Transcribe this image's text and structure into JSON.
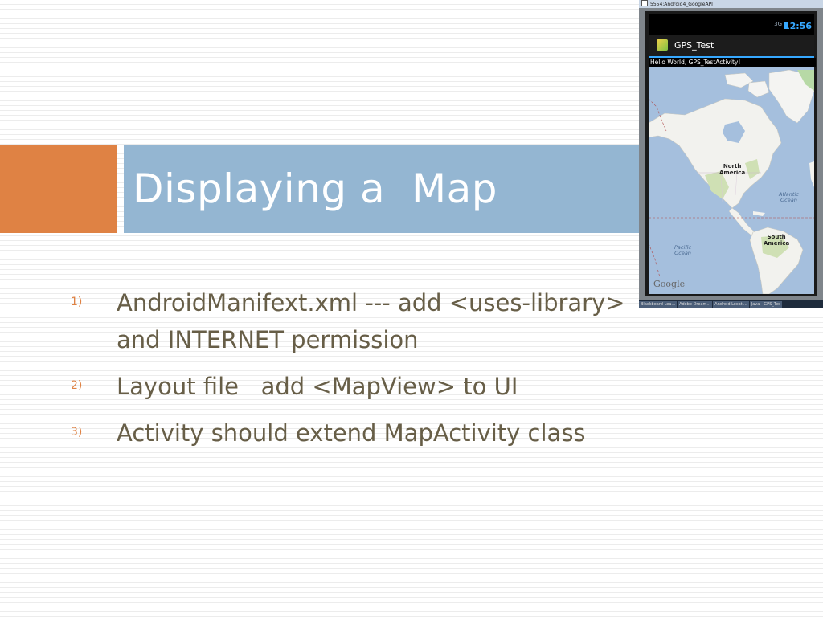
{
  "slide": {
    "title": "Displaying a  Map",
    "bullets": [
      {
        "num": "1)",
        "text": "AndroidManifext.xml --- add <uses-library>\nand INTERNET permission"
      },
      {
        "num": "2)",
        "text": "Layout file   add <MapView> to UI"
      },
      {
        "num": "3)",
        "text": "Activity should extend MapActivity class"
      }
    ]
  },
  "emulator": {
    "window_title": "5554:Android4_GoogleAPI",
    "signal": "3G",
    "time": "12:56",
    "app_title": "GPS_Test",
    "hello_text": "Hello World, GPS_TestActivity!",
    "map": {
      "labels": {
        "north_america": "North\nAmerica",
        "south_america": "South\nAmerica",
        "atlantic": "Atlantic\nOcean",
        "pacific": "Pacific\nOcean"
      },
      "logo": "Google"
    },
    "taskbar": [
      "Blackboard Lea...",
      "Adobe Dream...",
      "Android Locati...",
      "Java - GPS_Tes"
    ]
  },
  "colors": {
    "accent": "#df8244",
    "title_bar": "#94b6d2",
    "body_text": "#675e47",
    "android_blue": "#36a8ff"
  }
}
